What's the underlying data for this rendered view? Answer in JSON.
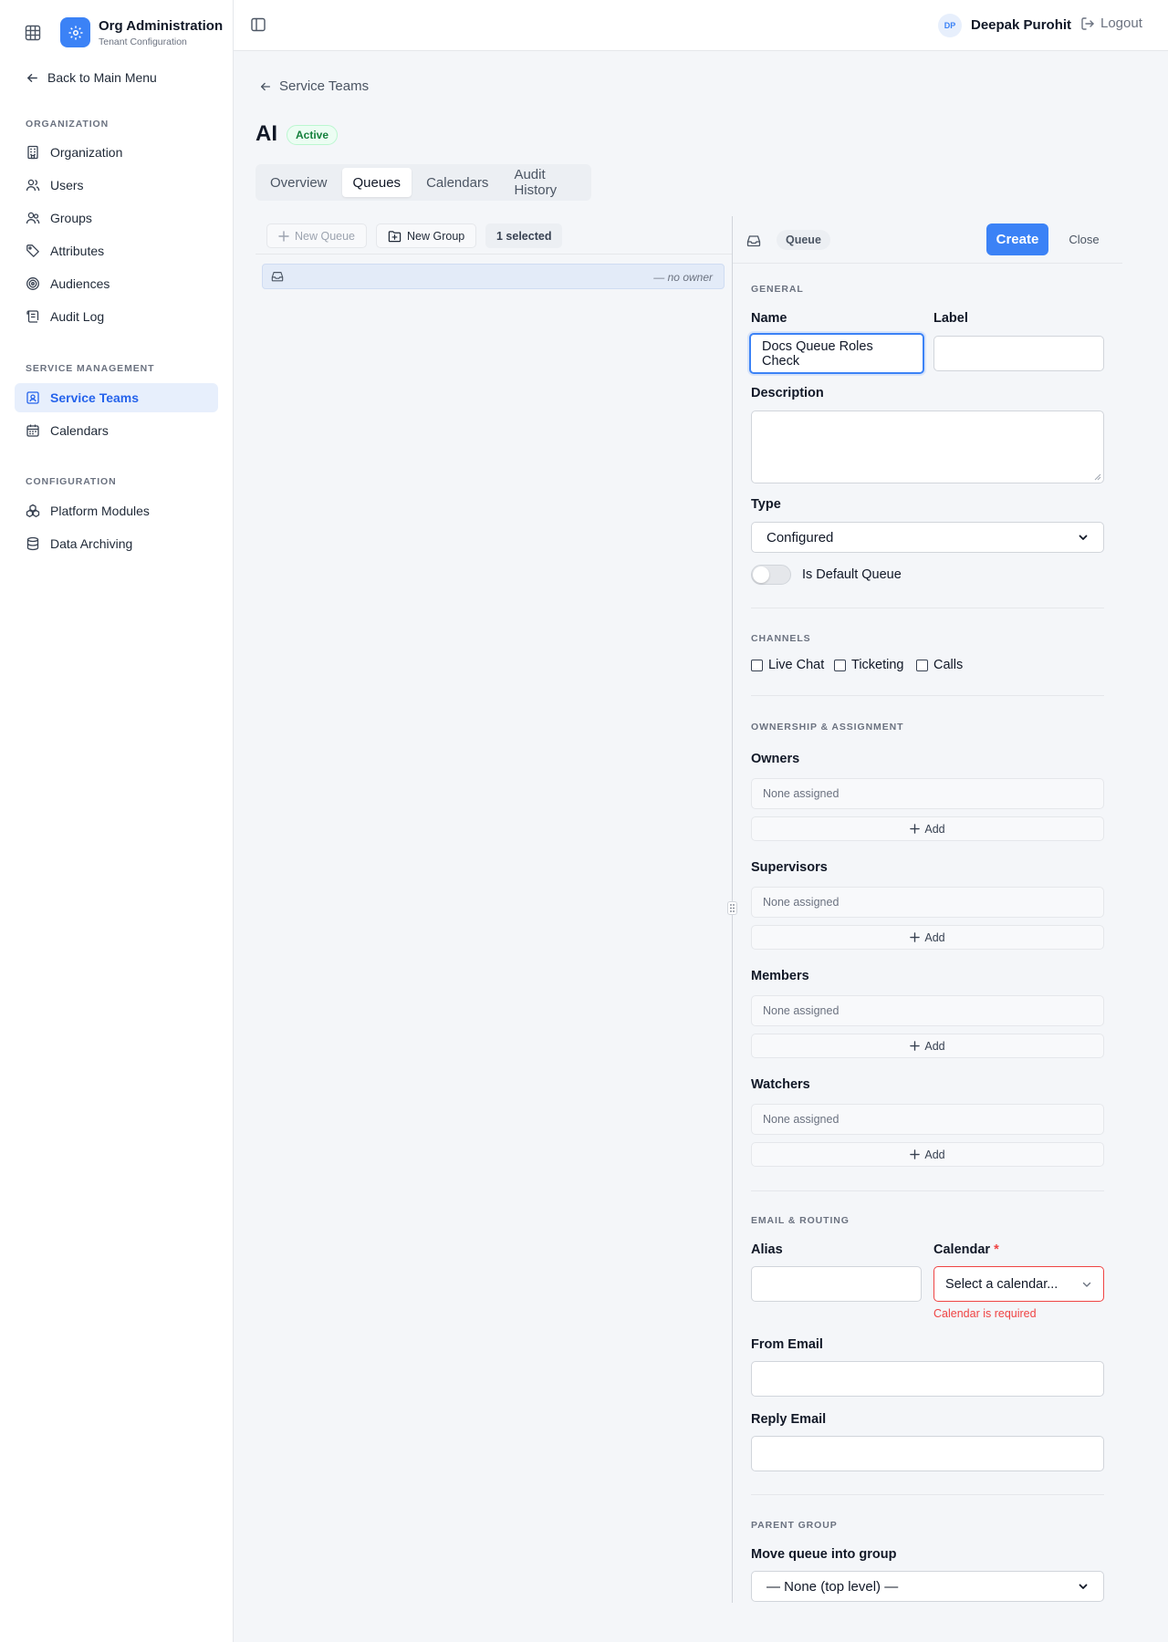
{
  "brand": {
    "title": "Org Administration",
    "subtitle": "Tenant Configuration"
  },
  "sidebar": {
    "back_label": "Back to Main Menu",
    "sections": [
      {
        "label": "ORGANIZATION",
        "items": [
          "Organization",
          "Users",
          "Groups",
          "Attributes",
          "Audiences",
          "Audit Log"
        ]
      },
      {
        "label": "SERVICE MANAGEMENT",
        "items": [
          "Service Teams",
          "Calendars"
        ]
      },
      {
        "label": "CONFIGURATION",
        "items": [
          "Platform Modules",
          "Data Archiving"
        ]
      }
    ],
    "active_item": "Service Teams"
  },
  "header": {
    "avatar_initials": "DP",
    "user_name": "Deepak Purohit",
    "logout_label": "Logout"
  },
  "page": {
    "breadcrumb": "Service Teams",
    "title": "AI",
    "status": "Active",
    "tabs": [
      "Overview",
      "Queues",
      "Calendars",
      "Audit History"
    ],
    "active_tab": "Queues"
  },
  "toolbar": {
    "new_queue": "New Queue",
    "new_group": "New Group",
    "selected_count": "1 selected"
  },
  "queue_list": [
    {
      "name": "",
      "owner": "— no owner"
    }
  ],
  "panel": {
    "type_chip": "Queue",
    "create_label": "Create",
    "close_label": "Close",
    "general": {
      "heading": "GENERAL",
      "name_label": "Name",
      "name_value": "Docs Queue Roles Check",
      "label_label": "Label",
      "label_value": "",
      "description_label": "Description",
      "description_value": "",
      "type_label": "Type",
      "type_value": "Configured",
      "default_toggle_label": "Is Default Queue",
      "default_toggle_on": false
    },
    "channels": {
      "heading": "CHANNELS",
      "options": [
        {
          "label": "Live Chat",
          "checked": false
        },
        {
          "label": "Ticketing",
          "checked": false
        },
        {
          "label": "Calls",
          "checked": false
        }
      ]
    },
    "ownership": {
      "heading": "OWNERSHIP & ASSIGNMENT",
      "groups": [
        {
          "label": "Owners",
          "empty_text": "None assigned",
          "add_label": "Add"
        },
        {
          "label": "Supervisors",
          "empty_text": "None assigned",
          "add_label": "Add"
        },
        {
          "label": "Members",
          "empty_text": "None assigned",
          "add_label": "Add"
        },
        {
          "label": "Watchers",
          "empty_text": "None assigned",
          "add_label": "Add"
        }
      ]
    },
    "email_routing": {
      "heading": "EMAIL & ROUTING",
      "alias_label": "Alias",
      "alias_value": "",
      "calendar_label": "Calendar",
      "required_mark": "*",
      "calendar_placeholder": "Select a calendar...",
      "calendar_error": "Calendar is required",
      "from_email_label": "From Email",
      "from_email_value": "",
      "reply_email_label": "Reply Email",
      "reply_email_value": ""
    },
    "parent_group": {
      "heading": "PARENT GROUP",
      "move_label": "Move queue into group",
      "move_value": "— None (top level) —"
    }
  },
  "colors": {
    "accent": "#3b82f6",
    "active_bg": "#e7effc",
    "error": "#ef4444",
    "success": "#15803d"
  }
}
